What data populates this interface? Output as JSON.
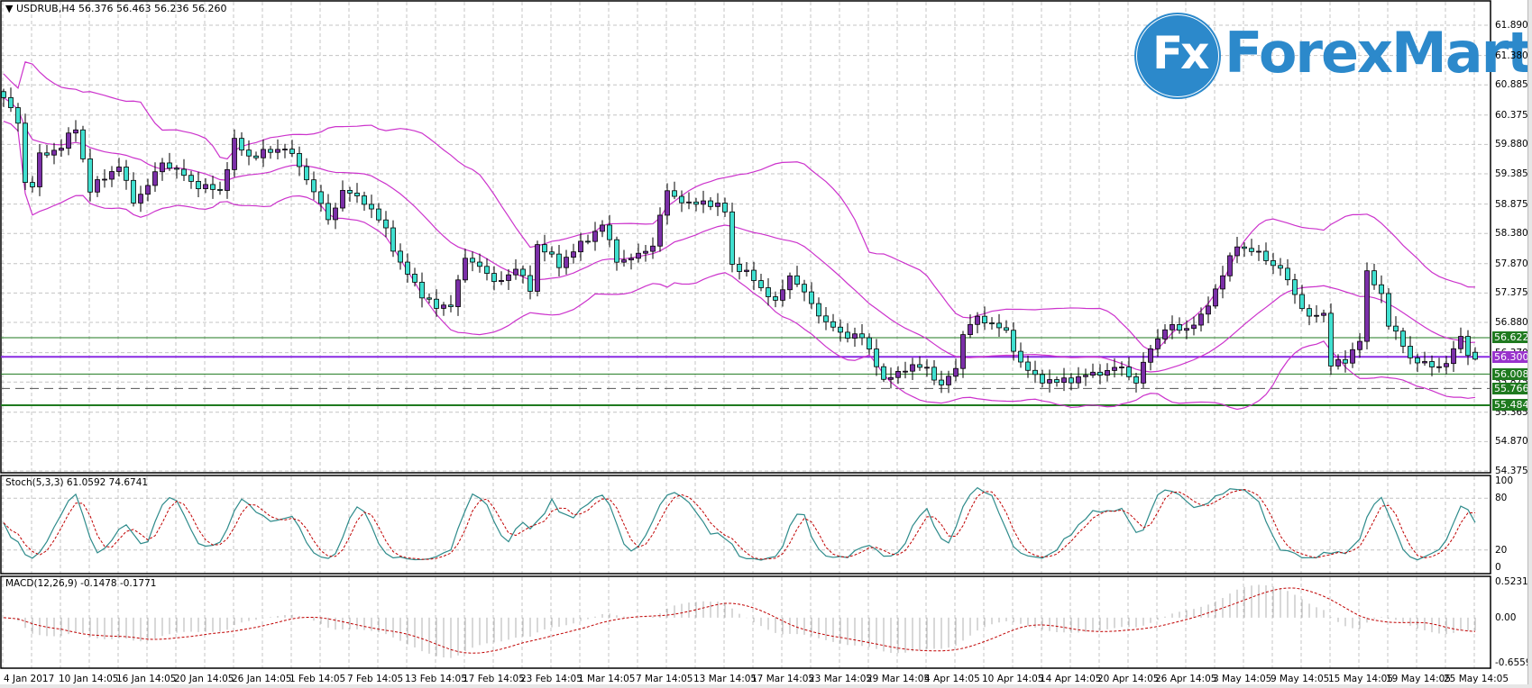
{
  "header": {
    "symbol": "USDRUB,H4",
    "open": "56.376",
    "high": "56.463",
    "low": "56.236",
    "close": "56.260"
  },
  "logo": {
    "mark": "Fx",
    "text": "ForexMart"
  },
  "colors": {
    "bull": "#7b2fa8",
    "bear": "#40e0d0",
    "bands": "#cc33cc",
    "stoch_main": "#2e8b8b",
    "stoch_signal": "#c00000",
    "macd_hist": "#b0b0b0",
    "level_green": "#1f7a1f",
    "level_purple": "#9933cc"
  },
  "chart_data": [
    {
      "type": "candlestick",
      "title": "USDRUB,H4",
      "ylim": [
        54.375,
        61.89
      ],
      "y_ticks": [
        "61.890",
        "61.380",
        "60.885",
        "60.375",
        "59.880",
        "59.385",
        "58.875",
        "58.380",
        "57.870",
        "57.375",
        "56.880",
        "56.370",
        "55.875",
        "55.365",
        "54.870",
        "54.375"
      ],
      "x_tick_labels": [
        "4 Jan 2017",
        "10 Jan 14:05",
        "16 Jan 14:05",
        "20 Jan 14:05",
        "26 Jan 14:05",
        "1 Feb 14:05",
        "7 Feb 14:05",
        "13 Feb 14:05",
        "17 Feb 14:05",
        "23 Feb 14:05",
        "1 Mar 14:05",
        "7 Mar 14:05",
        "13 Mar 14:05",
        "17 Mar 14:05",
        "23 Mar 14:05",
        "29 Mar 14:05",
        "4 Apr 14:05",
        "10 Apr 14:05",
        "14 Apr 14:05",
        "20 Apr 14:05",
        "26 Apr 14:05",
        "3 May 14:05",
        "9 May 14:05",
        "15 May 14:05",
        "19 May 14:05",
        "25 May 14:05"
      ],
      "bars": 205,
      "close_anchors": [
        [
          0,
          60.67
        ],
        [
          2,
          60.25
        ],
        [
          3,
          59.26
        ],
        [
          4,
          59.18
        ],
        [
          5,
          59.68
        ],
        [
          8,
          59.84
        ],
        [
          10,
          60.17
        ],
        [
          12,
          59.1
        ],
        [
          14,
          59.34
        ],
        [
          16,
          59.51
        ],
        [
          18,
          58.93
        ],
        [
          20,
          59.18
        ],
        [
          22,
          59.59
        ],
        [
          24,
          59.43
        ],
        [
          27,
          59.18
        ],
        [
          30,
          59.1
        ],
        [
          32,
          59.92
        ],
        [
          34,
          59.68
        ],
        [
          37,
          59.76
        ],
        [
          39,
          59.84
        ],
        [
          41,
          59.51
        ],
        [
          43,
          59.1
        ],
        [
          45,
          58.6
        ],
        [
          47,
          59.1
        ],
        [
          50,
          58.93
        ],
        [
          53,
          58.44
        ],
        [
          55,
          57.86
        ],
        [
          58,
          57.36
        ],
        [
          60,
          57.11
        ],
        [
          62,
          57.2
        ],
        [
          64,
          57.94
        ],
        [
          66,
          57.86
        ],
        [
          68,
          57.53
        ],
        [
          71,
          57.78
        ],
        [
          73,
          57.45
        ],
        [
          74,
          58.19
        ],
        [
          77,
          57.86
        ],
        [
          80,
          58.19
        ],
        [
          83,
          58.52
        ],
        [
          85,
          57.94
        ],
        [
          87,
          57.94
        ],
        [
          90,
          58.19
        ],
        [
          92,
          59.1
        ],
        [
          95,
          58.85
        ],
        [
          97,
          58.93
        ],
        [
          100,
          58.77
        ],
        [
          101,
          57.86
        ],
        [
          104,
          57.61
        ],
        [
          107,
          57.2
        ],
        [
          109,
          57.69
        ],
        [
          111,
          57.36
        ],
        [
          114,
          56.87
        ],
        [
          116,
          56.7
        ],
        [
          119,
          56.62
        ],
        [
          121,
          56.2
        ],
        [
          122,
          55.87
        ],
        [
          125,
          56.12
        ],
        [
          128,
          56.12
        ],
        [
          130,
          55.79
        ],
        [
          132,
          56.12
        ],
        [
          133,
          56.7
        ],
        [
          135,
          56.95
        ],
        [
          137,
          56.87
        ],
        [
          139,
          56.7
        ],
        [
          141,
          56.2
        ],
        [
          143,
          55.95
        ],
        [
          146,
          55.87
        ],
        [
          149,
          55.95
        ],
        [
          152,
          56.04
        ],
        [
          155,
          56.12
        ],
        [
          157,
          55.87
        ],
        [
          159,
          56.45
        ],
        [
          161,
          56.78
        ],
        [
          164,
          56.78
        ],
        [
          166,
          56.95
        ],
        [
          169,
          57.69
        ],
        [
          171,
          58.19
        ],
        [
          174,
          58.03
        ],
        [
          177,
          57.78
        ],
        [
          179,
          57.36
        ],
        [
          181,
          56.95
        ],
        [
          183,
          57.03
        ],
        [
          184,
          56.2
        ],
        [
          186,
          56.2
        ],
        [
          188,
          56.62
        ],
        [
          189,
          57.69
        ],
        [
          191,
          57.36
        ],
        [
          192,
          56.87
        ],
        [
          195,
          56.29
        ],
        [
          198,
          56.12
        ],
        [
          200,
          56.2
        ],
        [
          202,
          56.62
        ],
        [
          203,
          56.37
        ],
        [
          204,
          56.26
        ]
      ],
      "last_bar_ohlc": [
        56.376,
        56.463,
        56.236,
        56.26
      ],
      "indicators": [
        "Bollinger Bands(20,2)"
      ],
      "levels": [
        {
          "value": "56.622",
          "style": "solid",
          "color": "green"
        },
        {
          "value": "56.300",
          "style": "thick",
          "color": "purple"
        },
        {
          "value": "56.008",
          "style": "solid",
          "color": "green"
        },
        {
          "value": "55.766",
          "style": "dashed",
          "color": "green"
        },
        {
          "value": "55.484",
          "style": "thick",
          "color": "green"
        }
      ]
    },
    {
      "type": "line",
      "title": "Stoch(5,3,3) 61.0592 74.6741",
      "ylim": [
        0,
        100
      ],
      "y_ticks": [
        "100",
        "80",
        "20",
        "0"
      ],
      "levels": [
        80,
        20
      ],
      "series": [
        {
          "name": "main",
          "last": 61.0592
        },
        {
          "name": "signal",
          "last": 74.6741
        }
      ]
    },
    {
      "type": "bar",
      "title": "MACD(12,26,9) -0.1478 -0.1771",
      "ylim": [
        -0.6559,
        0.5231
      ],
      "y_ticks": [
        "0.5231",
        "0.00",
        "-0.6559"
      ],
      "series": [
        {
          "name": "macd",
          "last": -0.1478
        },
        {
          "name": "signal",
          "last": -0.1771
        }
      ]
    }
  ]
}
